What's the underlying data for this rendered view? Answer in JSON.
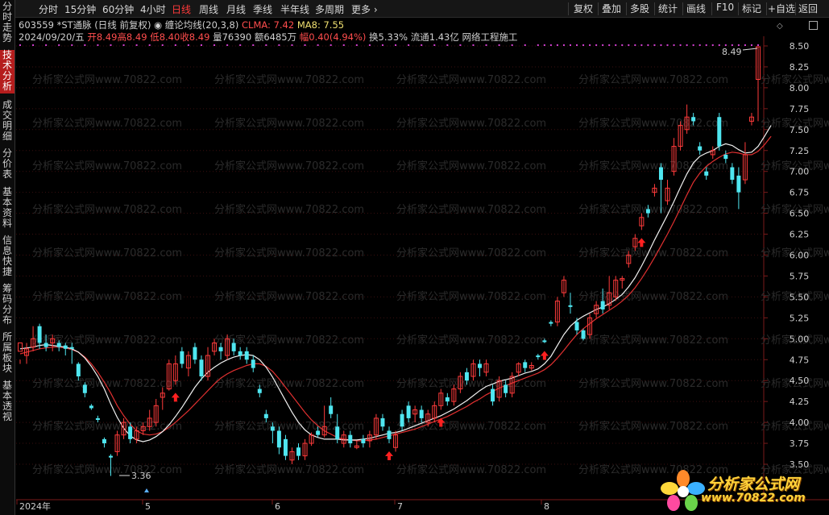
{
  "toolbar": {
    "periods": [
      "分时",
      "15分钟",
      "60分钟",
      "4小时",
      "日线",
      "周线",
      "月线",
      "季线",
      "半年线",
      "多周期",
      "更多"
    ],
    "active_period": "日线",
    "right_buttons": [
      "复权",
      "叠加",
      "多股",
      "统计",
      "画线",
      "F10",
      "标记",
      "+自选",
      "返回"
    ]
  },
  "sidebar": {
    "tabs": [
      "分时走势",
      "技术分析",
      "成交明细",
      "分价表",
      "基本资料",
      "信息快捷",
      "筹码分布",
      "所属板块",
      "基本透视"
    ],
    "active": "技术分析"
  },
  "stock": {
    "code": "603559",
    "name": "*ST通脉",
    "mode": "(日线 前复权)",
    "indicator": "缠论均线(20,3,8)",
    "clma_label": "CLMA: 7.42",
    "ma8_label": "MA8: 7.55"
  },
  "quote": {
    "date": "2024/09/20/五",
    "open": "开8.49",
    "high": "高8.49",
    "low": "低8.40",
    "close": "收8.49",
    "volume": "量76390",
    "amount": "额6485万",
    "change": "幅0.40(4.94%)",
    "turnover": "换5.33%",
    "float_cap": "流通1.43亿",
    "sector": "网络工程施工"
  },
  "annotations": {
    "high_marker": "8.49",
    "low_marker": "3.36"
  },
  "watermark": {
    "text": "分析家公式网www.70822.com"
  },
  "logo": {
    "name": "分析家公式网",
    "url": "www.70822.com"
  },
  "chart_data": {
    "type": "candlestick",
    "y_ticks": [
      "8.50",
      "8.25",
      "8.00",
      "7.75",
      "7.50",
      "7.25",
      "7.00",
      "6.75",
      "6.50",
      "6.25",
      "6.00",
      "5.75",
      "5.50",
      "5.25",
      "5.00",
      "4.75",
      "4.50",
      "4.25",
      "4.00",
      "3.75",
      "3.50"
    ],
    "ylim": [
      3.5,
      8.5
    ],
    "x_ticks": [
      "2024年",
      "5",
      "6",
      "7",
      "8"
    ],
    "colors": {
      "up": "#ff3b3b",
      "down": "#4fe6f0",
      "ma8": "#f0f0f0",
      "clma": "#e03030",
      "signal": "#ff2020",
      "dots": "#d040d0"
    },
    "candles": [
      [
        4.85,
        4.95,
        4.75,
        4.7
      ],
      [
        4.8,
        4.88,
        4.95,
        4.7
      ],
      [
        4.9,
        5.0,
        5.15,
        4.85
      ],
      [
        5.15,
        4.95,
        5.18,
        4.88
      ],
      [
        4.95,
        4.9,
        5.05,
        4.85
      ],
      [
        4.95,
        5.0,
        5.05,
        4.85
      ],
      [
        4.95,
        4.9,
        4.98,
        4.85
      ],
      [
        4.92,
        4.88,
        4.95,
        4.8
      ],
      [
        4.9,
        4.88,
        4.95,
        4.7
      ],
      [
        4.7,
        4.55,
        4.72,
        4.5
      ],
      [
        4.45,
        4.35,
        4.48,
        4.3
      ],
      [
        4.2,
        4.17,
        4.22,
        4.15
      ],
      [
        4.05,
        4.03,
        4.08,
        4.0
      ],
      [
        3.8,
        3.75,
        3.82,
        3.7
      ],
      [
        3.6,
        3.58,
        3.62,
        3.36
      ],
      [
        3.65,
        3.85,
        3.9,
        3.6
      ],
      [
        3.85,
        4.0,
        4.05,
        3.8
      ],
      [
        3.95,
        3.8,
        4.0,
        3.75
      ],
      [
        3.8,
        3.9,
        3.95,
        3.75
      ],
      [
        3.9,
        3.95,
        4.0,
        3.85
      ],
      [
        3.95,
        4.05,
        4.15,
        3.9
      ],
      [
        4.0,
        4.2,
        4.28,
        3.95
      ],
      [
        4.3,
        4.35,
        4.42,
        4.15
      ],
      [
        4.4,
        4.7,
        4.75,
        4.38
      ],
      [
        4.5,
        4.7,
        4.8,
        4.45
      ],
      [
        4.85,
        4.7,
        4.9,
        4.65
      ],
      [
        4.65,
        4.8,
        4.85,
        4.55
      ],
      [
        4.9,
        4.75,
        4.95,
        4.7
      ],
      [
        4.75,
        4.55,
        4.8,
        4.5
      ],
      [
        4.55,
        4.8,
        4.9,
        4.5
      ],
      [
        4.85,
        4.95,
        5.0,
        4.8
      ],
      [
        4.9,
        4.85,
        4.95,
        4.75
      ],
      [
        4.8,
        5.0,
        5.05,
        4.75
      ],
      [
        4.95,
        4.85,
        5.0,
        4.8
      ],
      [
        4.85,
        4.8,
        4.9,
        4.75
      ],
      [
        4.85,
        4.75,
        4.9,
        4.7
      ],
      [
        4.75,
        4.65,
        4.8,
        4.6
      ],
      [
        4.4,
        4.35,
        4.45,
        4.3
      ],
      [
        4.1,
        4.05,
        4.15,
        4.0
      ],
      [
        3.95,
        3.9,
        4.0,
        3.75
      ],
      [
        3.9,
        3.7,
        3.95,
        3.62
      ],
      [
        3.8,
        3.6,
        3.85,
        3.55
      ],
      [
        3.55,
        3.65,
        3.7,
        3.5
      ],
      [
        3.7,
        3.6,
        3.75,
        3.55
      ],
      [
        3.6,
        3.75,
        3.8,
        3.55
      ],
      [
        3.75,
        3.85,
        3.88,
        3.72
      ],
      [
        3.9,
        3.85,
        3.95,
        3.82
      ],
      [
        3.85,
        3.95,
        4.2,
        3.82
      ],
      [
        4.2,
        4.1,
        4.3,
        4.05
      ],
      [
        3.95,
        3.8,
        4.1,
        3.75
      ],
      [
        3.75,
        3.85,
        3.9,
        3.7
      ],
      [
        3.85,
        3.75,
        3.9,
        3.7
      ],
      [
        3.7,
        3.72,
        3.78,
        3.68
      ],
      [
        3.8,
        3.75,
        3.85,
        3.7
      ],
      [
        3.78,
        3.85,
        3.9,
        3.7
      ],
      [
        3.85,
        4.05,
        4.1,
        3.8
      ],
      [
        4.05,
        3.95,
        4.1,
        3.9
      ],
      [
        3.9,
        3.8,
        3.95,
        3.75
      ],
      [
        3.7,
        3.85,
        3.9,
        3.65
      ],
      [
        4.1,
        3.95,
        4.15,
        3.9
      ],
      [
        4.2,
        4.05,
        4.25,
        4.0
      ],
      [
        4.1,
        4.15,
        4.2,
        4.0
      ],
      [
        4.15,
        4.05,
        4.2,
        4.0
      ],
      [
        4.0,
        4.1,
        4.15,
        3.95
      ],
      [
        4.05,
        4.2,
        4.25,
        4.0
      ],
      [
        4.2,
        4.35,
        4.4,
        4.15
      ],
      [
        4.3,
        4.25,
        4.35,
        4.2
      ],
      [
        4.25,
        4.4,
        4.45,
        4.2
      ],
      [
        4.4,
        4.55,
        4.6,
        4.35
      ],
      [
        4.6,
        4.5,
        4.65,
        4.45
      ],
      [
        4.55,
        4.7,
        4.75,
        4.5
      ],
      [
        4.7,
        4.65,
        4.75,
        4.55
      ],
      [
        4.6,
        4.7,
        4.75,
        4.55
      ],
      [
        4.4,
        4.25,
        4.45,
        4.2
      ],
      [
        4.3,
        4.5,
        4.55,
        4.25
      ],
      [
        4.45,
        4.35,
        4.5,
        4.3
      ],
      [
        4.35,
        4.55,
        4.6,
        4.3
      ],
      [
        4.6,
        4.7,
        4.72,
        4.55
      ],
      [
        4.72,
        4.65,
        4.75,
        4.6
      ],
      [
        4.65,
        4.68,
        4.72,
        4.62
      ],
      [
        4.8,
        4.78,
        4.82,
        4.75
      ],
      [
        4.98,
        4.96,
        5.0,
        4.95
      ],
      [
        5.2,
        5.18,
        5.22,
        5.15
      ],
      [
        5.2,
        5.45,
        5.5,
        5.15
      ],
      [
        5.55,
        5.7,
        5.75,
        5.5
      ],
      [
        5.4,
        5.38,
        5.55,
        5.3
      ],
      [
        5.2,
        5.1,
        5.25,
        5.05
      ],
      [
        5.1,
        5.0,
        5.12,
        4.98
      ],
      [
        5.05,
        5.25,
        5.3,
        5.0
      ],
      [
        5.3,
        5.4,
        5.45,
        5.25
      ],
      [
        5.45,
        5.35,
        5.6,
        5.3
      ],
      [
        5.4,
        5.55,
        5.75,
        5.35
      ],
      [
        5.5,
        5.7,
        5.75,
        5.45
      ],
      [
        5.7,
        5.72,
        5.75,
        5.6
      ],
      [
        5.9,
        6.0,
        6.05,
        5.85
      ],
      [
        6.1,
        6.2,
        6.25,
        6.05
      ],
      [
        6.35,
        6.45,
        6.5,
        6.3
      ],
      [
        6.55,
        6.5,
        6.6,
        6.45
      ],
      [
        6.75,
        6.8,
        6.85,
        6.7
      ],
      [
        7.05,
        6.9,
        7.1,
        6.5
      ],
      [
        6.65,
        6.8,
        6.9,
        6.6
      ],
      [
        7.0,
        7.3,
        7.4,
        6.95
      ],
      [
        7.3,
        7.55,
        7.6,
        7.25
      ],
      [
        7.5,
        7.65,
        7.8,
        7.45
      ],
      [
        7.65,
        7.6,
        7.7,
        7.55
      ],
      [
        7.3,
        7.25,
        7.35,
        7.2
      ],
      [
        7.0,
        6.95,
        7.05,
        6.9
      ],
      [
        7.2,
        7.25,
        7.3,
        7.15
      ],
      [
        7.65,
        7.3,
        7.7,
        7.25
      ],
      [
        7.2,
        7.15,
        7.25,
        7.1
      ],
      [
        7.05,
        6.9,
        7.1,
        6.85
      ],
      [
        6.95,
        6.75,
        7.05,
        6.55
      ],
      [
        6.9,
        7.2,
        7.35,
        6.85
      ],
      [
        7.6,
        7.65,
        7.7,
        7.55
      ],
      [
        8.1,
        8.49,
        8.49,
        7.6
      ]
    ],
    "ma8": [
      4.88,
      4.89,
      4.9,
      4.92,
      4.93,
      4.92,
      4.91,
      4.9,
      4.88,
      4.84,
      4.77,
      4.67,
      4.55,
      4.4,
      4.22,
      4.06,
      3.93,
      3.84,
      3.79,
      3.77,
      3.79,
      3.83,
      3.89,
      3.97,
      4.07,
      4.18,
      4.3,
      4.42,
      4.52,
      4.6,
      4.66,
      4.71,
      4.75,
      4.78,
      4.8,
      4.81,
      4.8,
      4.75,
      4.66,
      4.54,
      4.4,
      4.26,
      4.12,
      4.0,
      3.91,
      3.85,
      3.82,
      3.8,
      3.8,
      3.8,
      3.79,
      3.79,
      3.79,
      3.8,
      3.81,
      3.83,
      3.85,
      3.87,
      3.88,
      3.9,
      3.93,
      3.96,
      3.99,
      4.02,
      4.05,
      4.08,
      4.12,
      4.16,
      4.21,
      4.26,
      4.32,
      4.38,
      4.43,
      4.46,
      4.49,
      4.51,
      4.53,
      4.56,
      4.59,
      4.61,
      4.64,
      4.7,
      4.79,
      4.92,
      5.05,
      5.15,
      5.22,
      5.27,
      5.31,
      5.35,
      5.38,
      5.42,
      5.47,
      5.53,
      5.62,
      5.73,
      5.87,
      6.02,
      6.18,
      6.33,
      6.48,
      6.64,
      6.81,
      6.97,
      7.1,
      7.18,
      7.22,
      7.25,
      7.3,
      7.33,
      7.31,
      7.26,
      7.22,
      7.23,
      7.3,
      7.42,
      7.55
    ],
    "clma": [
      4.82,
      4.84,
      4.86,
      4.88,
      4.89,
      4.9,
      4.9,
      4.89,
      4.87,
      4.84,
      4.78,
      4.7,
      4.6,
      4.48,
      4.35,
      4.2,
      4.08,
      3.98,
      3.9,
      3.86,
      3.85,
      3.86,
      3.89,
      3.94,
      4.0,
      4.07,
      4.14,
      4.22,
      4.3,
      4.38,
      4.46,
      4.53,
      4.58,
      4.62,
      4.65,
      4.68,
      4.7,
      4.7,
      4.67,
      4.61,
      4.52,
      4.42,
      4.32,
      4.22,
      4.12,
      4.03,
      3.96,
      3.9,
      3.86,
      3.82,
      3.8,
      3.79,
      3.78,
      3.78,
      3.79,
      3.8,
      3.82,
      3.84,
      3.86,
      3.88,
      3.9,
      3.92,
      3.95,
      3.98,
      4.01,
      4.04,
      4.07,
      4.11,
      4.15,
      4.19,
      4.24,
      4.28,
      4.33,
      4.37,
      4.41,
      4.44,
      4.47,
      4.5,
      4.53,
      4.56,
      4.59,
      4.63,
      4.69,
      4.77,
      4.86,
      4.96,
      5.05,
      5.12,
      5.18,
      5.24,
      5.29,
      5.34,
      5.39,
      5.45,
      5.52,
      5.61,
      5.72,
      5.84,
      5.97,
      6.11,
      6.25,
      6.4,
      6.56,
      6.72,
      6.87,
      6.98,
      7.06,
      7.12,
      7.17,
      7.21,
      7.23,
      7.22,
      7.2,
      7.2,
      7.24,
      7.32,
      7.42
    ],
    "signals": [
      24,
      57,
      65,
      81,
      96
    ]
  }
}
